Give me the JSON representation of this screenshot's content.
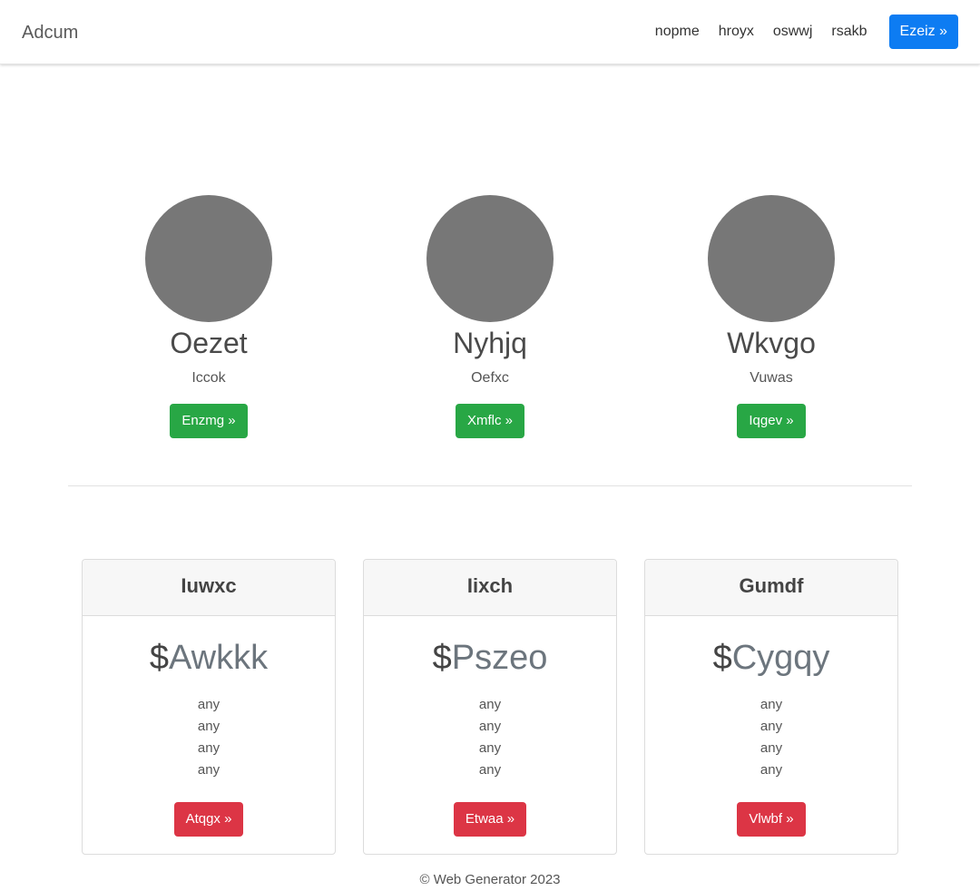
{
  "navbar": {
    "brand": "Adcum",
    "links": [
      "nopme",
      "hroyx",
      "oswwj",
      "rsakb"
    ],
    "cta_label": "Ezeiz »",
    "cta_color": "#0d7cf2"
  },
  "members": [
    {
      "name": "Oezet",
      "role": "Iccok",
      "button": "Enzmg »"
    },
    {
      "name": "Nyhjq",
      "role": "Oefxc",
      "button": "Xmflc »"
    },
    {
      "name": "Wkvgo",
      "role": "Vuwas",
      "button": "Iqgev »"
    }
  ],
  "pricing": [
    {
      "title": "Iuwxc",
      "currency": "$",
      "price": "Awkkk",
      "features": [
        "any",
        "any",
        "any",
        "any"
      ],
      "button": "Atqgx »"
    },
    {
      "title": "Iixch",
      "currency": "$",
      "price": "Pszeo",
      "features": [
        "any",
        "any",
        "any",
        "any"
      ],
      "button": "Etwaa »"
    },
    {
      "title": "Gumdf",
      "currency": "$",
      "price": "Cygqy",
      "features": [
        "any",
        "any",
        "any",
        "any"
      ],
      "button": "Vlwbf »"
    }
  ],
  "footer": "© Web Generator 2023",
  "colors": {
    "success": "#28a745",
    "danger": "#dc3545",
    "avatar": "#777777"
  }
}
